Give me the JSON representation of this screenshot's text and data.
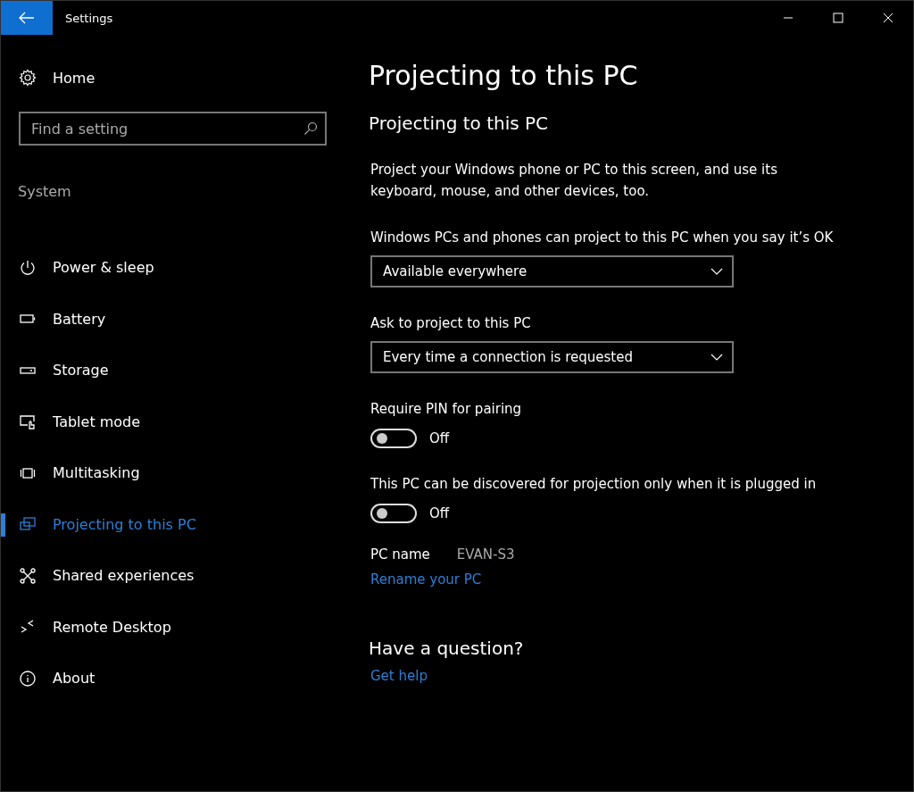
{
  "window": {
    "title": "Settings"
  },
  "sidebar": {
    "home": "Home",
    "search": {
      "placeholder": "Find a setting"
    },
    "section": "System",
    "items": [
      {
        "label": "Power & sleep",
        "kind": "power",
        "selected": false
      },
      {
        "label": "Battery",
        "kind": "battery",
        "selected": false
      },
      {
        "label": "Storage",
        "kind": "storage",
        "selected": false
      },
      {
        "label": "Tablet mode",
        "kind": "tablet",
        "selected": false
      },
      {
        "label": "Multitasking",
        "kind": "multitask",
        "selected": false
      },
      {
        "label": "Projecting to this PC",
        "kind": "project",
        "selected": true
      },
      {
        "label": "Shared experiences",
        "kind": "shared",
        "selected": false
      },
      {
        "label": "Remote Desktop",
        "kind": "remote",
        "selected": false
      },
      {
        "label": "About",
        "kind": "about",
        "selected": false
      }
    ]
  },
  "page": {
    "title": "Projecting to this PC",
    "subtitle": "Projecting to this PC",
    "description": "Project your Windows phone or PC to this screen, and use its keyboard, mouse, and other devices, too.",
    "settings": [
      {
        "kind": "dropdown",
        "label": "Windows PCs and phones can project to this PC when you say it’s OK",
        "value": "Available everywhere"
      },
      {
        "kind": "dropdown",
        "label": "Ask to project to this PC",
        "value": "Every time a connection is requested"
      },
      {
        "kind": "toggle",
        "label": "Require PIN for pairing",
        "on": false,
        "state": "Off"
      },
      {
        "kind": "toggle",
        "label": "This PC can be discovered for projection only when it is plugged in",
        "on": false,
        "state": "Off"
      }
    ],
    "pc_name_label": "PC name",
    "pc_name": "EVAN-S3",
    "rename_link": "Rename your PC",
    "question": "Have a question?",
    "help_link": "Get help"
  }
}
